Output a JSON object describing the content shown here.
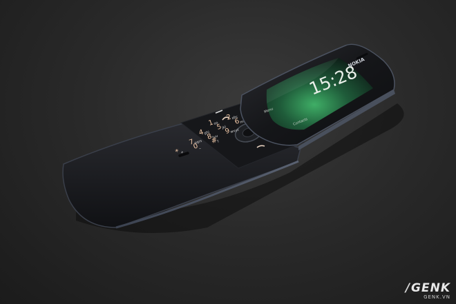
{
  "photo": {
    "subject": "slider phone on dark table",
    "colors": {
      "table": "#2a2a2a",
      "phone_body": "#141518",
      "screen_glow": "#3fae66",
      "key_text": "#f2c9a8",
      "screen_text": "#e9efe9"
    }
  },
  "phone": {
    "brand": "NOKIA",
    "clock": "15:28",
    "softkey_left": "Menu",
    "softkey_right": "Contacts",
    "keys": [
      {
        "label": "1",
        "glyph": "oo"
      },
      {
        "label": "2",
        "glyph": "abc"
      },
      {
        "label": "3",
        "glyph": "def"
      },
      {
        "label": "4",
        "glyph": "ghi"
      },
      {
        "label": "5",
        "glyph": "jkl"
      },
      {
        "label": "6",
        "glyph": "mno"
      },
      {
        "label": "7",
        "glyph": "pqrs"
      },
      {
        "label": "8",
        "glyph": "tuv"
      },
      {
        "label": "9",
        "glyph": "wxyz"
      },
      {
        "label": "*",
        "glyph": "+"
      },
      {
        "label": "0",
        "glyph": "_"
      },
      {
        "label": "#",
        "glyph": "⇧"
      }
    ]
  },
  "watermark": {
    "logo": "GENK",
    "site": "GENK.VN"
  }
}
